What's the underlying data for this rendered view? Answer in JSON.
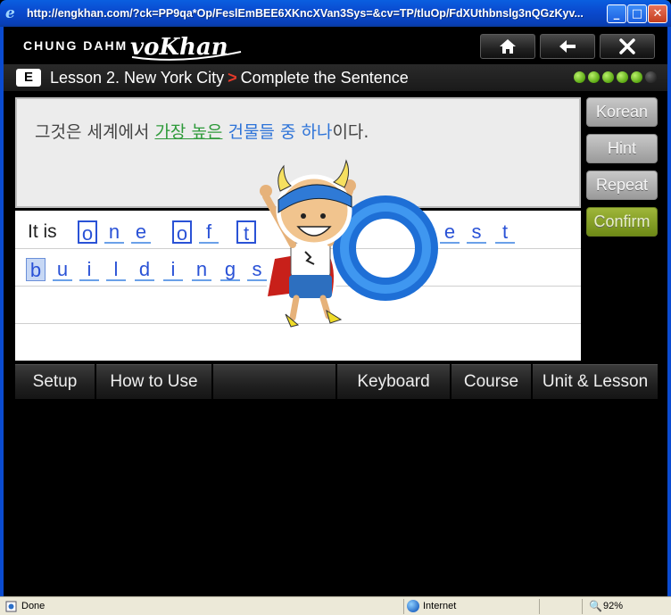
{
  "browser": {
    "url_title": "http://engkhan.com/?ck=PP9qa*Op/FeslEmBEE6XKncXVan3Sys=&cv=TP/tluOp/FdXUthbnslg3nQGzKyv...",
    "status": {
      "text": "Done",
      "zone": "Internet",
      "zoom": "92%"
    }
  },
  "header": {
    "brand": "CHUNG DAHM",
    "logo_text": "voKhan",
    "buttons": {
      "home": "home-icon",
      "back": "arrow-left-icon",
      "close": "close-icon"
    }
  },
  "lesson": {
    "level": "E",
    "title": "Lesson 2. New York City",
    "separator": ">",
    "section": "Complete the Sentence",
    "progress": {
      "filled": 5,
      "total": 6
    }
  },
  "prompt": {
    "prefix": "그것은 세계에서 ",
    "highlight_green": "가장 높은",
    "space": " ",
    "highlight_blue": "건물들 중 하나",
    "suffix": "이다."
  },
  "answer": {
    "lead": "It is",
    "line1": [
      "o",
      "n",
      "e",
      "o",
      "f",
      "t",
      "e",
      "s",
      "t"
    ],
    "line2": [
      "b",
      "u",
      "i",
      "l",
      "d",
      "i",
      "n",
      "g",
      "s"
    ]
  },
  "side_buttons": {
    "korean": "Korean",
    "hint": "Hint",
    "repeat": "Repeat",
    "confirm": "Confirm"
  },
  "nav": {
    "setup": "Setup",
    "how_to_use": "How to Use",
    "keyboard": "Keyboard",
    "course": "Course",
    "unit_lesson": "Unit & Lesson"
  },
  "colors": {
    "titlebar": "#0a4bd0",
    "confirm": "#7e9a1e",
    "answer_blue": "#2a52d6",
    "korean_green": "#2e9a3a",
    "korean_blue": "#2d73d8"
  }
}
